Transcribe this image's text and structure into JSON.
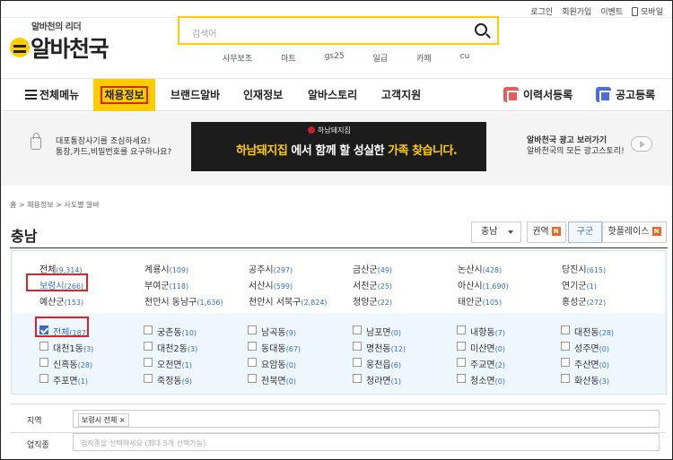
{
  "top_links": [
    "로그인",
    "회원가입",
    "이벤트",
    "모바일"
  ],
  "logo": {
    "tagline": "알바천의 리더",
    "name": "알바천국"
  },
  "search": {
    "placeholder": "검색어"
  },
  "keywords": [
    "사무보조",
    "마트",
    "gs25",
    "일급",
    "카페",
    "cu"
  ],
  "nav": {
    "menu_label": "전체메뉴",
    "items": [
      "채용정보",
      "브랜드알바",
      "인재정보",
      "알바스토리",
      "고객지원"
    ],
    "resume_btn": "이력서등록",
    "post_btn": "공고등록",
    "colors": {
      "active": "#ffcc00",
      "resume_icon": "#ea5a5a",
      "post_icon": "#4a6fd8"
    }
  },
  "notice": {
    "line1": "대포통장사기를 조심하세요!",
    "line2": "통장,카드,비밀번호를 요구하나요?"
  },
  "ad": {
    "brand": "하남돼지집",
    "copy_hl": "하남돼지집",
    "copy_mid": "에서 함께 할 성실한",
    "copy_hl2": "가족 찾습니다."
  },
  "promo": {
    "line1": "알바천국 광고 보러가기",
    "line2": "알바천국의 모든 광고스토리!"
  },
  "breadcrumb": "홈 > 채용정보 > 사도별 알바",
  "page_title": "충남",
  "region_select": "충남",
  "tabs": [
    {
      "label": "권역",
      "badge": "N"
    },
    {
      "label": "구군",
      "badge": ""
    },
    {
      "label": "핫플레이스",
      "badge": "N"
    }
  ],
  "cities": [
    {
      "name": "전체",
      "count": "(9,314)"
    },
    {
      "name": "계룡시",
      "count": "(109)"
    },
    {
      "name": "공주시",
      "count": "(297)"
    },
    {
      "name": "금산군",
      "count": "(49)"
    },
    {
      "name": "논산시",
      "count": "(428)"
    },
    {
      "name": "당진시",
      "count": "(615)"
    },
    {
      "name": "보령시",
      "count": "(266)"
    },
    {
      "name": "부여군",
      "count": "(118)"
    },
    {
      "name": "서산시",
      "count": "(599)"
    },
    {
      "name": "서천군",
      "count": "(25)"
    },
    {
      "name": "아산시",
      "count": "(1,690)"
    },
    {
      "name": "연기군",
      "count": "(1)"
    },
    {
      "name": "예산군",
      "count": "(153)"
    },
    {
      "name": "천안시 동남구",
      "count": "(1,636)"
    },
    {
      "name": "천안시 서북구",
      "count": "(2,824)"
    },
    {
      "name": "청양군",
      "count": "(22)"
    },
    {
      "name": "태안군",
      "count": "(105)"
    },
    {
      "name": "홍성군",
      "count": "(272)"
    }
  ],
  "dongs": [
    {
      "name": "전체",
      "count": "(187)"
    },
    {
      "name": "궁촌동",
      "count": "(10)"
    },
    {
      "name": "남곡동",
      "count": "(9)"
    },
    {
      "name": "남포면",
      "count": "(0)"
    },
    {
      "name": "내항동",
      "count": "(7)"
    },
    {
      "name": "대천동",
      "count": "(28)"
    },
    {
      "name": "대천1동",
      "count": "(3)"
    },
    {
      "name": "대천2동",
      "count": "(3)"
    },
    {
      "name": "동대동",
      "count": "(67)"
    },
    {
      "name": "명천동",
      "count": "(12)"
    },
    {
      "name": "미산면",
      "count": "(0)"
    },
    {
      "name": "성주면",
      "count": "(0)"
    },
    {
      "name": "신흑동",
      "count": "(28)"
    },
    {
      "name": "오천면",
      "count": "(1)"
    },
    {
      "name": "요암동",
      "count": "(0)"
    },
    {
      "name": "웅천읍",
      "count": "(6)"
    },
    {
      "name": "주교면",
      "count": "(2)"
    },
    {
      "name": "주산면",
      "count": "(0)"
    },
    {
      "name": "주포면",
      "count": "(1)"
    },
    {
      "name": "죽정동",
      "count": "(9)"
    },
    {
      "name": "천북면",
      "count": "(0)"
    },
    {
      "name": "청라면",
      "count": "(1)"
    },
    {
      "name": "청소면",
      "count": "(0)"
    },
    {
      "name": "화산동",
      "count": "(3)"
    }
  ],
  "filters": {
    "region_label": "지역",
    "region_chip": "보령시 전체 ×",
    "job_label": "업직종",
    "job_placeholder": "업직종을 선택하세요 (최대 5개 선택가능)"
  }
}
